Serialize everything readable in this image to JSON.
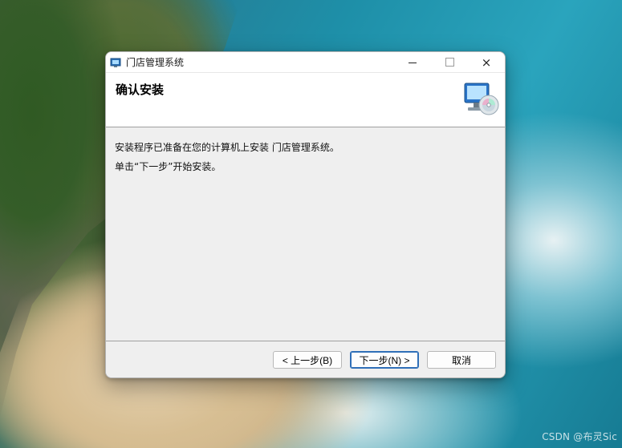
{
  "window": {
    "title": "门店管理系统",
    "controls": {
      "minimize": "—",
      "maximize": "□",
      "close": "×"
    }
  },
  "header": {
    "title": "确认安装"
  },
  "content": {
    "line1": "安装程序已准备在您的计算机上安装 门店管理系统。",
    "line2": "单击“下一步”开始安装。"
  },
  "buttons": {
    "back": "< 上一步(B)",
    "next": "下一步(N) >",
    "cancel": "取消"
  },
  "watermark": "CSDN @布灵Sic",
  "icons": {
    "window": "installer-icon",
    "header": "computer-cd-icon"
  },
  "colors": {
    "accent": "#2f6fb8"
  }
}
